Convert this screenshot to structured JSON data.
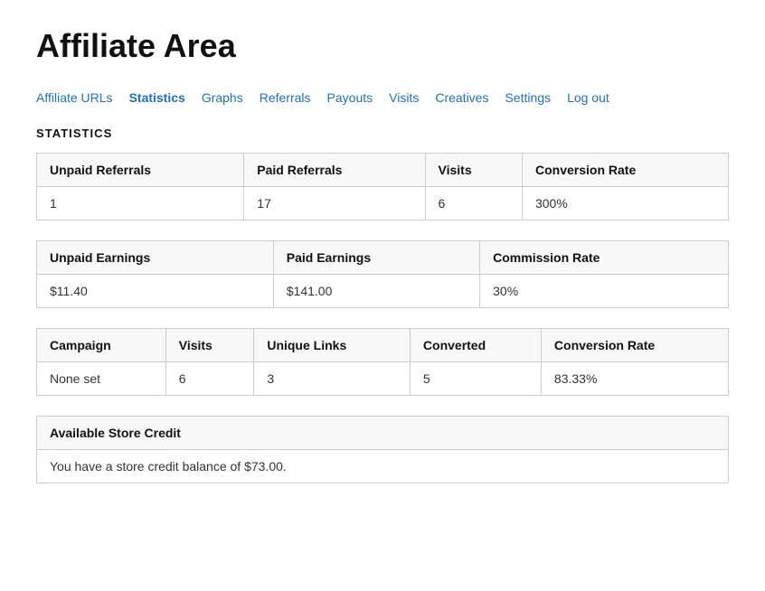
{
  "page": {
    "title": "Affiliate Area"
  },
  "nav": {
    "items": [
      {
        "label": "Affiliate URLs",
        "active": false
      },
      {
        "label": "Statistics",
        "active": true
      },
      {
        "label": "Graphs",
        "active": false
      },
      {
        "label": "Referrals",
        "active": false
      },
      {
        "label": "Payouts",
        "active": false
      },
      {
        "label": "Visits",
        "active": false
      },
      {
        "label": "Creatives",
        "active": false
      },
      {
        "label": "Settings",
        "active": false
      },
      {
        "label": "Log out",
        "active": false
      }
    ]
  },
  "section_title": "STATISTICS",
  "table1": {
    "headers": [
      "Unpaid Referrals",
      "Paid Referrals",
      "Visits",
      "Conversion Rate"
    ],
    "rows": [
      [
        "1",
        "17",
        "6",
        "300%"
      ]
    ]
  },
  "table2": {
    "headers": [
      "Unpaid Earnings",
      "Paid Earnings",
      "Commission Rate"
    ],
    "rows": [
      [
        "$11.40",
        "$141.00",
        "30%"
      ]
    ]
  },
  "table3": {
    "headers": [
      "Campaign",
      "Visits",
      "Unique Links",
      "Converted",
      "Conversion Rate"
    ],
    "rows": [
      [
        "None set",
        "6",
        "3",
        "5",
        "83.33%"
      ]
    ]
  },
  "store_credit": {
    "header": "Available Store Credit",
    "body": "You have a store credit balance of $73.00."
  }
}
